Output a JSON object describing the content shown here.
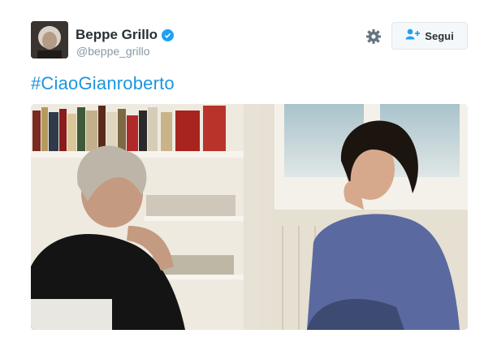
{
  "tweet": {
    "author": {
      "display_name": "Beppe Grillo",
      "handle": "@beppe_grillo",
      "verified": true
    },
    "text_hashtag": "#CiaoGianroberto",
    "follow_button": {
      "label": "Segui",
      "icon": "add-user-icon"
    },
    "settings_icon": "gear-icon",
    "media": {
      "type": "photo",
      "alt": ""
    }
  },
  "colors": {
    "link": "#1b95e0",
    "verified": "#1da1f2",
    "name": "#292f33",
    "handle": "#8899a6"
  }
}
